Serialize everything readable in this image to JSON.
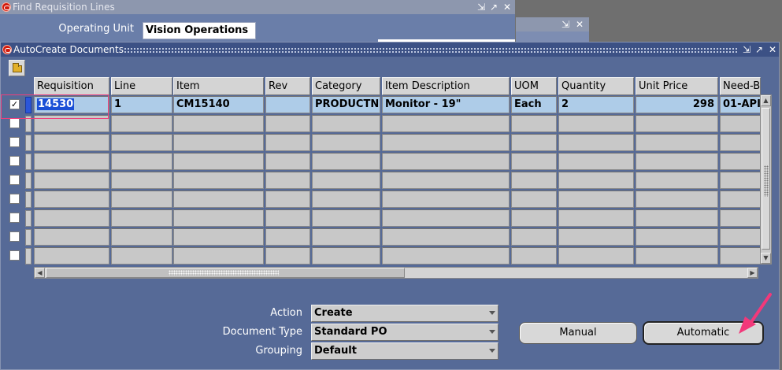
{
  "find_window": {
    "title": "Find Requisition Lines",
    "operating_unit_label": "Operating Unit",
    "operating_unit_value": "Vision Operations"
  },
  "autocreate_window": {
    "title": "AutoCreate Documents",
    "columns": [
      "Requisition",
      "Line",
      "Item",
      "Rev",
      "Category",
      "Item Description",
      "UOM",
      "Quantity",
      "Unit Price",
      "Need-B"
    ],
    "rows": [
      {
        "checked": true,
        "cells": [
          "14530",
          "1",
          "CM15140",
          "",
          "PRODUCTN.I",
          "Monitor - 19\"",
          "Each",
          "2",
          "298",
          "01-API"
        ]
      },
      {
        "checked": false,
        "cells": [
          "",
          "",
          "",
          "",
          "",
          "",
          "",
          "",
          "",
          ""
        ]
      },
      {
        "checked": false,
        "cells": [
          "",
          "",
          "",
          "",
          "",
          "",
          "",
          "",
          "",
          ""
        ]
      },
      {
        "checked": false,
        "cells": [
          "",
          "",
          "",
          "",
          "",
          "",
          "",
          "",
          "",
          ""
        ]
      },
      {
        "checked": false,
        "cells": [
          "",
          "",
          "",
          "",
          "",
          "",
          "",
          "",
          "",
          ""
        ]
      },
      {
        "checked": false,
        "cells": [
          "",
          "",
          "",
          "",
          "",
          "",
          "",
          "",
          "",
          ""
        ]
      },
      {
        "checked": false,
        "cells": [
          "",
          "",
          "",
          "",
          "",
          "",
          "",
          "",
          "",
          ""
        ]
      },
      {
        "checked": false,
        "cells": [
          "",
          "",
          "",
          "",
          "",
          "",
          "",
          "",
          "",
          ""
        ]
      },
      {
        "checked": false,
        "cells": [
          "",
          "",
          "",
          "",
          "",
          "",
          "",
          "",
          "",
          ""
        ]
      }
    ],
    "action_label": "Action",
    "action_value": "Create",
    "document_type_label": "Document Type",
    "document_type_value": "Standard PO",
    "grouping_label": "Grouping",
    "grouping_value": "Default",
    "manual_label": "Manual",
    "automatic_label": "Automatic",
    "check_mark": "✓"
  },
  "icons": {
    "oracle_logo": "oracle-icon",
    "toolbar": "folder-icon",
    "annotation": "pink-arrow",
    "annotation_color": "#f2387a"
  }
}
